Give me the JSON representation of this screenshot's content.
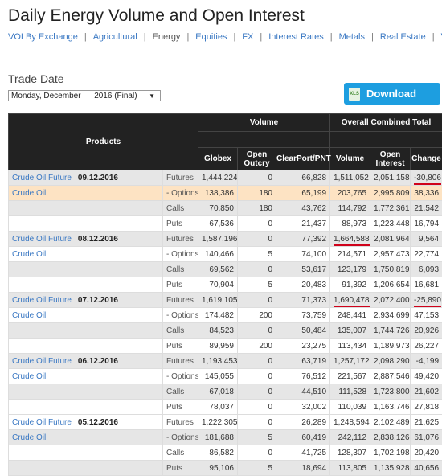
{
  "title": "Daily Energy Volume and Open Interest",
  "nav": {
    "items": [
      {
        "label": "VOI By Exchange",
        "current": false
      },
      {
        "label": "Agricultural",
        "current": false
      },
      {
        "label": "Energy",
        "current": true
      },
      {
        "label": "Equities",
        "current": false
      },
      {
        "label": "FX",
        "current": false
      },
      {
        "label": "Interest Rates",
        "current": false
      },
      {
        "label": "Metals",
        "current": false
      },
      {
        "label": "Real Estate",
        "current": false
      },
      {
        "label": "V",
        "current": false
      }
    ],
    "separator": "|"
  },
  "trade_date": {
    "label": "Trade Date",
    "selected": "Monday, December      2016 (Final)",
    "arrow": "▼"
  },
  "download": {
    "label": "Download Data",
    "icon_text": "XLS",
    "color": "#1d9ee0"
  },
  "table": {
    "headers": {
      "products": "Products",
      "volume": "Volume",
      "overall": "Overall Combined Total",
      "globex": "Globex",
      "open_outcry": "Open Outcry",
      "clearport": "ClearPort/PNT",
      "total_volume": "Volume",
      "open_interest": "Open Interest",
      "change": "Change"
    },
    "groups": [
      {
        "future": "Crude Oil Future",
        "date": "09.12.2016",
        "option": "Crude Oil",
        "rows": [
          {
            "type": "Futures",
            "globex": "1,444,224",
            "outcry": "0",
            "clearport": "66,828",
            "volume": "1,511,052",
            "oi": "2,051,158",
            "change": "-30,806",
            "bg": "g",
            "ul_change": true
          },
          {
            "type": "- Options",
            "globex": "138,386",
            "outcry": "180",
            "clearport": "65,199",
            "volume": "203,765",
            "oi": "2,995,809",
            "change": "38,336",
            "bg": "o"
          },
          {
            "type": "Calls",
            "globex": "70,850",
            "outcry": "180",
            "clearport": "43,762",
            "volume": "114,792",
            "oi": "1,772,361",
            "change": "21,542",
            "bg": "g"
          },
          {
            "type": "Puts",
            "globex": "67,536",
            "outcry": "0",
            "clearport": "21,437",
            "volume": "88,973",
            "oi": "1,223,448",
            "change": "16,794",
            "bg": "w"
          }
        ]
      },
      {
        "future": "Crude Oil Future",
        "date": "08.12.2016",
        "option": "Crude Oil",
        "rows": [
          {
            "type": "Futures",
            "globex": "1,587,196",
            "outcry": "0",
            "clearport": "77,392",
            "volume": "1,664,588",
            "oi": "2,081,964",
            "change": "9,564",
            "bg": "g",
            "ul_volume": true
          },
          {
            "type": "- Options",
            "globex": "140,466",
            "outcry": "5",
            "clearport": "74,100",
            "volume": "214,571",
            "oi": "2,957,473",
            "change": "22,774",
            "bg": "w"
          },
          {
            "type": "Calls",
            "globex": "69,562",
            "outcry": "0",
            "clearport": "53,617",
            "volume": "123,179",
            "oi": "1,750,819",
            "change": "6,093",
            "bg": "g"
          },
          {
            "type": "Puts",
            "globex": "70,904",
            "outcry": "5",
            "clearport": "20,483",
            "volume": "91,392",
            "oi": "1,206,654",
            "change": "16,681",
            "bg": "w"
          }
        ]
      },
      {
        "future": "Crude Oil Future",
        "date": "07.12.2016",
        "option": "Crude Oil",
        "rows": [
          {
            "type": "Futures",
            "globex": "1,619,105",
            "outcry": "0",
            "clearport": "71,373",
            "volume": "1,690,478",
            "oi": "2,072,400",
            "change": "-25,890",
            "bg": "g",
            "ul_volume": true,
            "ul_change": true
          },
          {
            "type": "- Options",
            "globex": "174,482",
            "outcry": "200",
            "clearport": "73,759",
            "volume": "248,441",
            "oi": "2,934,699",
            "change": "47,153",
            "bg": "w"
          },
          {
            "type": "Calls",
            "globex": "84,523",
            "outcry": "0",
            "clearport": "50,484",
            "volume": "135,007",
            "oi": "1,744,726",
            "change": "20,926",
            "bg": "g"
          },
          {
            "type": "Puts",
            "globex": "89,959",
            "outcry": "200",
            "clearport": "23,275",
            "volume": "113,434",
            "oi": "1,189,973",
            "change": "26,227",
            "bg": "w"
          }
        ]
      },
      {
        "future": "Crude Oil Future",
        "date": "06.12.2016",
        "option": "Crude Oil",
        "rows": [
          {
            "type": "Futures",
            "globex": "1,193,453",
            "outcry": "0",
            "clearport": "63,719",
            "volume": "1,257,172",
            "oi": "2,098,290",
            "change": "-4,199",
            "bg": "g"
          },
          {
            "type": "- Options",
            "globex": "145,055",
            "outcry": "0",
            "clearport": "76,512",
            "volume": "221,567",
            "oi": "2,887,546",
            "change": "49,420",
            "bg": "w"
          },
          {
            "type": "Calls",
            "globex": "67,018",
            "outcry": "0",
            "clearport": "44,510",
            "volume": "111,528",
            "oi": "1,723,800",
            "change": "21,602",
            "bg": "g"
          },
          {
            "type": "Puts",
            "globex": "78,037",
            "outcry": "0",
            "clearport": "32,002",
            "volume": "110,039",
            "oi": "1,163,746",
            "change": "27,818",
            "bg": "w"
          }
        ]
      },
      {
        "future": "Crude Oil Future",
        "date": "05.12.2016",
        "option": "Crude Oil",
        "rows": [
          {
            "type": "Futures",
            "globex": "1,222,305",
            "outcry": "0",
            "clearport": "26,289",
            "volume": "1,248,594",
            "oi": "2,102,489",
            "change": "21,625",
            "bg": "w"
          },
          {
            "type": "- Options",
            "globex": "181,688",
            "outcry": "5",
            "clearport": "60,419",
            "volume": "242,112",
            "oi": "2,838,126",
            "change": "61,076",
            "bg": "g"
          },
          {
            "type": "Calls",
            "globex": "86,582",
            "outcry": "0",
            "clearport": "41,725",
            "volume": "128,307",
            "oi": "1,702,198",
            "change": "20,420",
            "bg": "w"
          },
          {
            "type": "Puts",
            "globex": "95,106",
            "outcry": "5",
            "clearport": "18,694",
            "volume": "113,805",
            "oi": "1,135,928",
            "change": "40,656",
            "bg": "g"
          }
        ]
      }
    ]
  }
}
